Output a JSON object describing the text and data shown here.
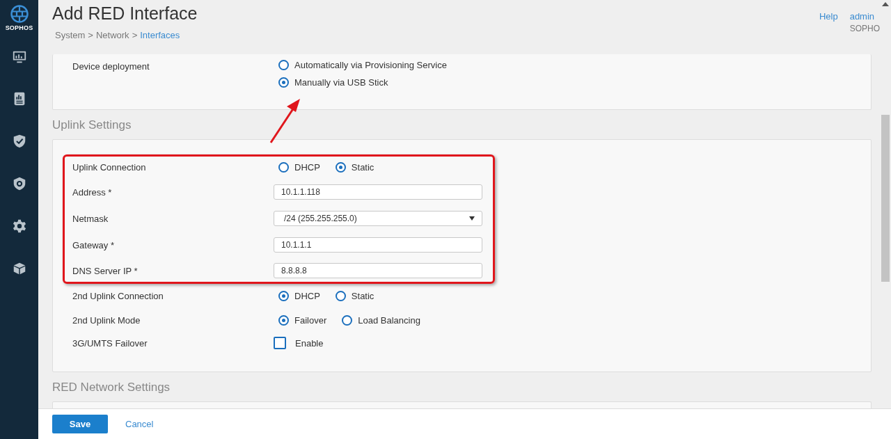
{
  "sidebar": {
    "logo": "SOPHOS",
    "items": [
      {
        "kind": "monitor"
      },
      {
        "kind": "report"
      },
      {
        "kind": "shield"
      },
      {
        "kind": "protect"
      },
      {
        "kind": "gear"
      },
      {
        "kind": "box"
      }
    ]
  },
  "header": {
    "title": "Add RED Interface",
    "breadcrumb": [
      {
        "label": "System",
        "link": false
      },
      {
        "label": "Network",
        "link": false
      },
      {
        "label": "Interfaces",
        "link": true
      }
    ],
    "separator": ">",
    "help": "Help",
    "user": "admin",
    "org": "SOPHO"
  },
  "device_deployment": {
    "label": "Device deployment",
    "options": [
      {
        "label": "Automatically via Provisioning Service",
        "selected": false
      },
      {
        "label": "Manually via USB Stick",
        "selected": true
      }
    ]
  },
  "uplink": {
    "title": "Uplink Settings",
    "rows": [
      {
        "kind": "radio",
        "label": "Uplink Connection",
        "options": [
          {
            "label": "DHCP",
            "selected": false
          },
          {
            "label": "Static",
            "selected": true
          }
        ]
      },
      {
        "kind": "text",
        "label": "Address *",
        "value": "10.1.1.118"
      },
      {
        "kind": "select",
        "label": "Netmask",
        "value": "/24 (255.255.255.0)"
      },
      {
        "kind": "text",
        "label": "Gateway *",
        "value": "10.1.1.1"
      },
      {
        "kind": "text",
        "label": "DNS Server IP *",
        "value": "8.8.8.8"
      },
      {
        "kind": "radio",
        "label": "2nd Uplink Connection",
        "options": [
          {
            "label": "DHCP",
            "selected": true
          },
          {
            "label": "Static",
            "selected": false
          }
        ]
      },
      {
        "kind": "radio",
        "label": "2nd Uplink Mode",
        "options": [
          {
            "label": "Failover",
            "selected": true
          },
          {
            "label": "Load Balancing",
            "selected": false
          }
        ]
      },
      {
        "kind": "checkbox",
        "label": "3G/UMTS Failover",
        "option": "Enable",
        "checked": false
      }
    ]
  },
  "red_network": {
    "title": "RED Network Settings"
  },
  "footer": {
    "save": "Save",
    "cancel": "Cancel"
  }
}
